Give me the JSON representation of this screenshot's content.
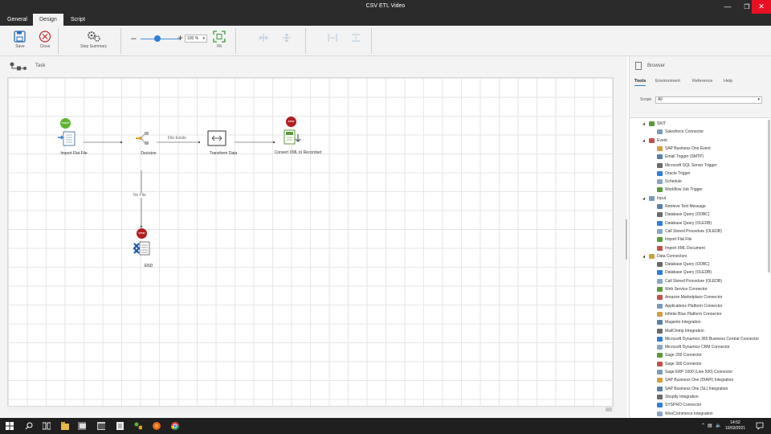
{
  "window": {
    "title": "CSV ETL Video"
  },
  "tabs": [
    "General",
    "Design",
    "Script"
  ],
  "ribbon": {
    "save": "Save",
    "close": "Close",
    "step_summary": "Step Summary",
    "zoom": "100 %",
    "fit": "Fit"
  },
  "designer": {
    "title": "Task",
    "nodes": {
      "import": {
        "label": "Import Flat File",
        "badge": "START"
      },
      "decision": {
        "label": "Decision"
      },
      "transform": {
        "label": "Transform Data"
      },
      "convert": {
        "label": "Convert XML to Recordset",
        "badge": "STOP"
      },
      "end": {
        "label": "END",
        "badge": "STOP"
      }
    },
    "connectors": {
      "file_exists": "File Exists",
      "no_file": "No File"
    }
  },
  "browser": {
    "title": "Browser",
    "tabs": [
      "Tools",
      "Environment",
      "Reference",
      "Help"
    ],
    "scope_label": "Scope",
    "scope_value": "All",
    "tree": [
      {
        "group": "SKIT",
        "items": [
          "Salesforce Connector"
        ]
      },
      {
        "group": "Event",
        "items": [
          "SAP Business One Event",
          "Email Trigger (SMTP)",
          "Microsoft SQL Server Trigger",
          "Oracle Trigger",
          "Schedule",
          "Workflow Job Trigger"
        ]
      },
      {
        "group": "Input",
        "items": [
          "Retrieve Text Message",
          "Database Query (ODBC)",
          "Database Query (OLEDB)",
          "Call Stored Procedure (OLEDB)",
          "Import Flat File",
          "Import XML Document"
        ]
      },
      {
        "group": "Data Connectors",
        "items": [
          "Database Query (ODBC)",
          "Database Query (OLEDB)",
          "Call Stored Procedure (OLEDB)",
          "Web Service Connector",
          "Amazon Marketplace Connector",
          "Applications Platform Connector",
          "Infinite Blue Platform Connector",
          "Magento Integration",
          "MailChimp Integration",
          "Microsoft Dynamics 365 Business Central Connector",
          "Microsoft Dynamics CRM Connector",
          "Sage 200 Connector",
          "Sage 300 Connector",
          "Sage ERP 1000 (Line 500) Connector",
          "SAP Business One (DIAPI) Integration",
          "SAP Business One (SL) Integration",
          "Shopify Integration",
          "SYSPRO Connector",
          "WooCommerce Integration"
        ]
      }
    ]
  },
  "taskbar": {
    "time": "14:52",
    "date": "10/03/2021"
  },
  "colors": {
    "accent": "#2f7ed8",
    "start": "#5cb531",
    "stop": "#b11f1f",
    "close": "#e81123"
  }
}
